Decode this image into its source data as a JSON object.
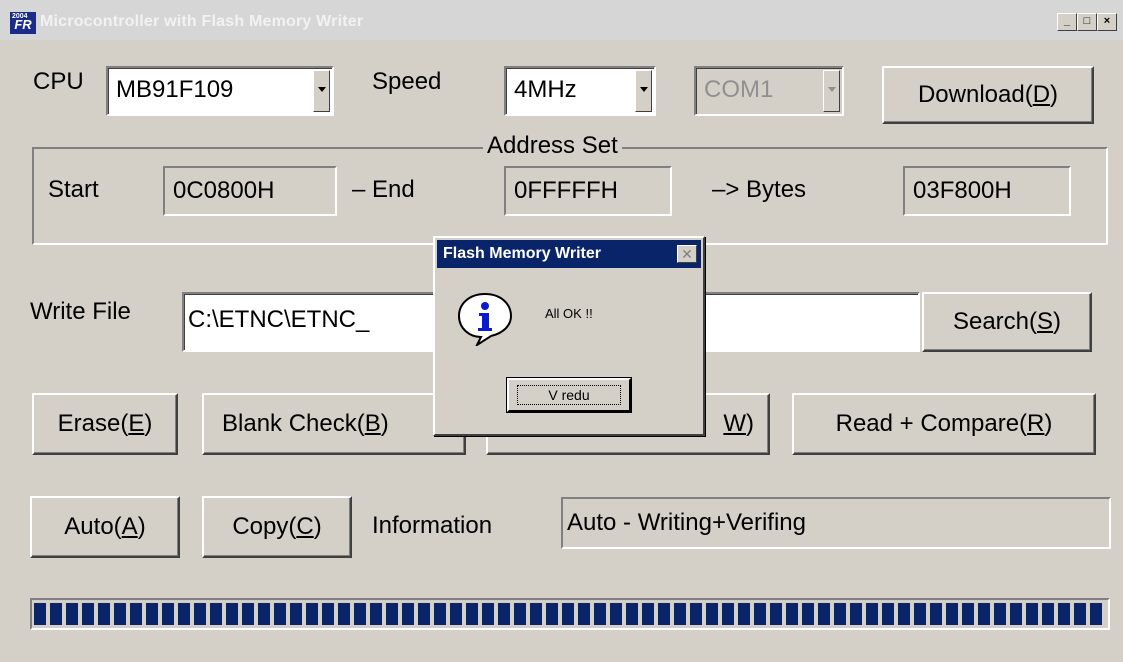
{
  "window": {
    "title": "Microcontroller with Flash Memory Writer",
    "icon_label": "FR",
    "controls": {
      "minimize": "_",
      "maximize": "□",
      "close": "×"
    }
  },
  "cpu": {
    "label": "CPU",
    "value": "MB91F109"
  },
  "speed": {
    "label": "Speed",
    "value": "4MHz"
  },
  "port": {
    "value": "COM1",
    "enabled": false
  },
  "download_button": {
    "pre": "Download(",
    "key": "D",
    "post": ")"
  },
  "address_set": {
    "title": "Address Set",
    "start_label": "Start",
    "start_value": "0C0800H",
    "end_label": "– End",
    "end_value": "0FFFFFH",
    "bytes_label": "–> Bytes",
    "bytes_value": "03F800H"
  },
  "write_file": {
    "label": "Write File",
    "value": "C:\\ETNC\\ETNC_"
  },
  "search_button": {
    "pre": "Search(",
    "key": "S",
    "post": ")"
  },
  "erase_button": {
    "pre": "Erase(",
    "key": "E",
    "post": ")"
  },
  "blank_check_button": {
    "pre": "Blank Check(",
    "key": "B",
    "post": ")"
  },
  "write_button_visible": {
    "key": "W",
    "post": ")"
  },
  "read_compare_button": {
    "pre": "Read + Compare(",
    "key": "R",
    "post": ")"
  },
  "auto_button": {
    "pre": "Auto(",
    "key": "A",
    "post": ")"
  },
  "copy_button": {
    "pre": "Copy(",
    "key": "C",
    "post": ")"
  },
  "information": {
    "label": "Information",
    "value": "Auto -  Writing+Verifing"
  },
  "progress": {
    "value": 1.0
  },
  "dialog": {
    "title": "Flash Memory Writer",
    "message": "All OK !!",
    "ok_label": "V redu",
    "icon": "info-icon"
  }
}
